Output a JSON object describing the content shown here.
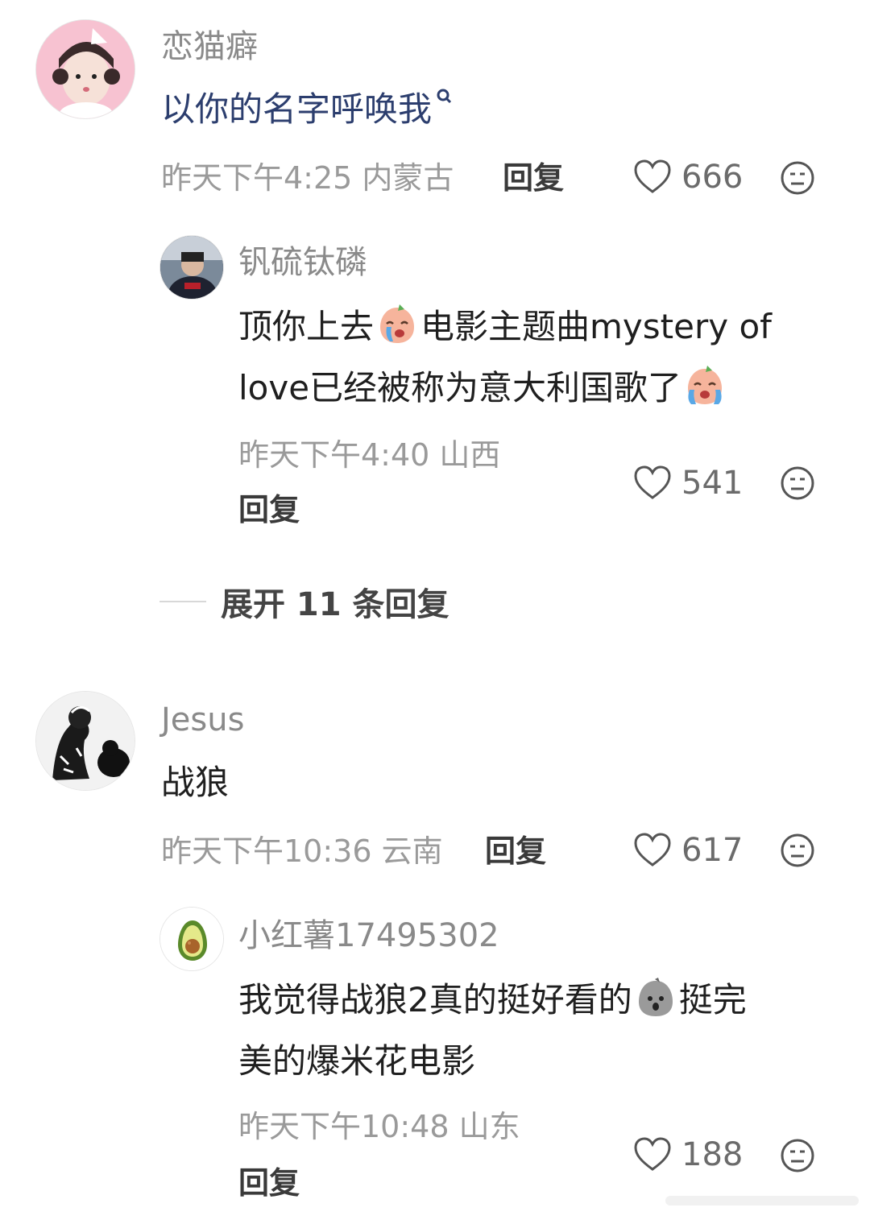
{
  "comments": [
    {
      "username": "恋猫癖",
      "text": "以你的名字呼唤我",
      "meta": "昨天下午4:25 内蒙古",
      "reply_label": "回复",
      "likes": "666"
    },
    {
      "username": "钒硫钛磷",
      "text_part1": "顶你上去",
      "text_part2": "电影主题曲mystery  of",
      "text_part3": "love已经被称为意大利国歌了",
      "meta": "昨天下午4:40 山西",
      "reply_label": "回复",
      "likes": "541"
    },
    {
      "username": "Jesus",
      "text": "战狼",
      "meta": "昨天下午10:36 云南",
      "reply_label": "回复",
      "likes": "617"
    },
    {
      "username": "小红薯17495302",
      "text_part1": "我觉得战狼2真的挺好看的",
      "text_part2": "挺完",
      "text_part3": "美的爆米花电影",
      "meta": "昨天下午10:48 山东",
      "reply_label": "回复",
      "likes": "188"
    }
  ],
  "expand_replies": "展开 11 条回复",
  "colors": {
    "link": "#2c3e6e",
    "meta": "#9a9a9a",
    "username": "#8a8a8a"
  }
}
